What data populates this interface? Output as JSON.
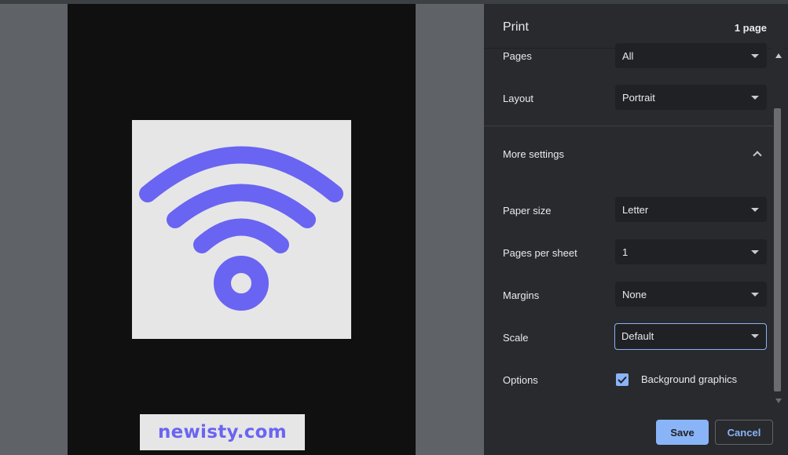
{
  "preview": {
    "brand_text": "newisty.com",
    "logo_icon": "wifi-icon",
    "logo_color": "#6a64f2"
  },
  "panel": {
    "title": "Print",
    "page_count": "1 page",
    "settings": {
      "pages": {
        "label": "Pages",
        "value": "All"
      },
      "layout": {
        "label": "Layout",
        "value": "Portrait"
      },
      "more_settings_label": "More settings",
      "paper_size": {
        "label": "Paper size",
        "value": "Letter"
      },
      "pages_per_sheet": {
        "label": "Pages per sheet",
        "value": "1"
      },
      "margins": {
        "label": "Margins",
        "value": "None"
      },
      "scale": {
        "label": "Scale",
        "value": "Default"
      },
      "options": {
        "label": "Options",
        "checkbox_label": "Background graphics",
        "checked": true
      }
    },
    "buttons": {
      "save": "Save",
      "cancel": "Cancel"
    },
    "colors": {
      "accent": "#8ab4f8",
      "panel_bg": "#292a2d"
    }
  }
}
